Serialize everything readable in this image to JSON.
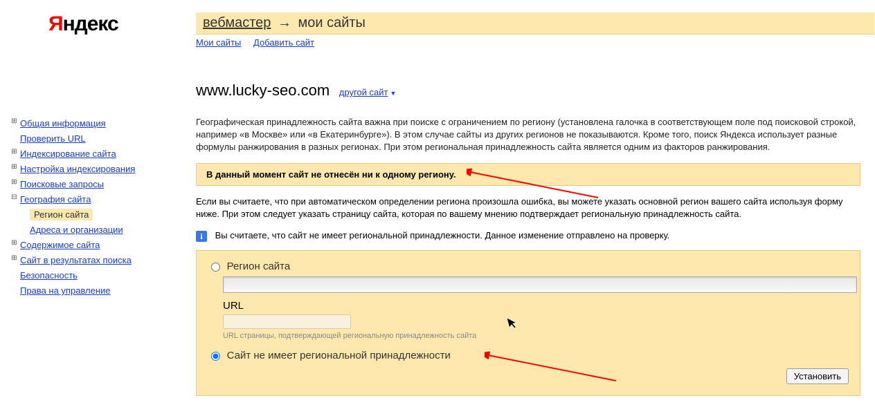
{
  "logo": {
    "first": "Я",
    "rest": "ндекс"
  },
  "breadcrumb": {
    "service": "вебмастер",
    "section": "мои сайты"
  },
  "sub_links": {
    "my_sites": "Мои сайты",
    "add_site": "Добавить сайт"
  },
  "sidebar": {
    "items": [
      {
        "label": "Общая информация",
        "expandable": true
      },
      {
        "label": "Проверить URL",
        "expandable": false
      },
      {
        "label": "Индексирование сайта",
        "expandable": true
      },
      {
        "label": "Настройка индексирования",
        "expandable": true
      },
      {
        "label": "Поисковые запросы",
        "expandable": true
      },
      {
        "label": "География сайта",
        "expandable": true,
        "expanded": true
      },
      {
        "label": "Регион сайта",
        "sub": true,
        "active": true
      },
      {
        "label": "Адреса и организации",
        "sub": true
      },
      {
        "label": "Содержимое сайта",
        "expandable": true
      },
      {
        "label": "Сайт в результатах поиска",
        "expandable": true
      },
      {
        "label": "Безопасность",
        "expandable": false
      },
      {
        "label": "Права на управление",
        "expandable": false
      }
    ]
  },
  "main": {
    "site": "www.lucky-seo.com",
    "other_site": "другой сайт",
    "desc": "Географическая принадлежность сайта важна при поиске с ограничением по региону (установлена галочка в соответствующем поле под поисковой строкой, например «в Москве» или «в Екатеринбурге»). В этом случае сайты из других регионов не показываются. Кроме того, поиск Яндекса использует разные формулы ранжирования в разных регионах. При этом региональная принадлежность сайта является одним из факторов ранжирования.",
    "notice": "В данный момент сайт не отнесён ни к одному региону.",
    "help_text": "Если вы считаете, что при автоматическом определении региона произошла ошибка, вы можете указать основной регион вашего сайта используя форму ниже. При этом следует указать страницу сайта, которая по вашему мнению подтверждает региональную принадлежность сайта.",
    "info_text": "Вы считаете, что сайт не имеет региональной принадлежности. Данное изменение отправлено на проверку.",
    "form": {
      "radio_region": "Регион сайта",
      "url_label": "URL",
      "url_hint": "URL страницы, подтверждающей региональную принадлежность сайта",
      "radio_no_region": "Сайт не имеет региональной принадлежности",
      "submit": "Установить"
    }
  }
}
